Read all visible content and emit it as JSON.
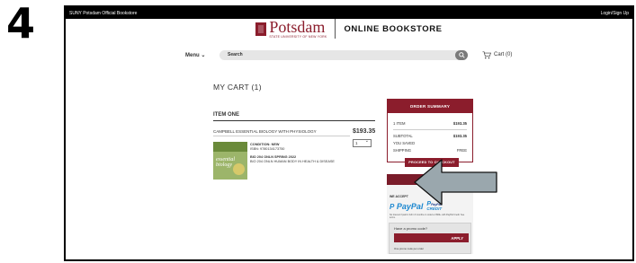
{
  "step_number": "4",
  "topbar": {
    "left": "SUNY Potsdam Official Bookstore",
    "right": "Login/Sign Up"
  },
  "logo": {
    "word": "Potsdam",
    "sub": "STATE UNIVERSITY OF NEW YORK",
    "store": "ONLINE BOOKSTORE"
  },
  "nav": {
    "menu": "Menu",
    "search_placeholder": "Search",
    "cart": "Cart (0)"
  },
  "cart": {
    "title": "MY CART (1)",
    "section": "ITEM ONE",
    "item": {
      "title": "CAMPBELL ESSENTIAL BIOLOGY WITH PHYSIOLOGY",
      "price": "$193.35",
      "qty": "1",
      "condition": "CONDITION: NEW",
      "isbn": "ISBN: 9780134173750",
      "course": "BIO 204 ONLN SPRING 2022",
      "course_desc": "BIO 204 ONLN HUMAN BODY IN HEALTH & DISEASE",
      "cover_text": "essential biology"
    }
  },
  "summary": {
    "title": "ORDER SUMMARY",
    "items_label": "1 ITEM",
    "items_value": "$193.35",
    "subtotal_label": "SUBTOTAL",
    "subtotal_value": "$193.35",
    "saved_label": "YOU SAVED",
    "shipping_label": "SHIPPING",
    "shipping_value": "FREE",
    "checkout": "PROCEED TO CHECKOUT"
  },
  "payment": {
    "accept": "WE ACCEPT",
    "paypal": "PayPal",
    "paypal_credit_top": "PayPal",
    "paypal_credit_bottom": "CREDIT",
    "fine": "No Interest if paid in full in 6 months on orders of $99+ with PayPal Credit. See terms.",
    "promo_title": "Have a promo code?",
    "apply": "APPLY",
    "promo_note": "One promo code per order"
  },
  "colors": {
    "brand": "#8b1d2c",
    "arrow": "#9aa7ad"
  }
}
